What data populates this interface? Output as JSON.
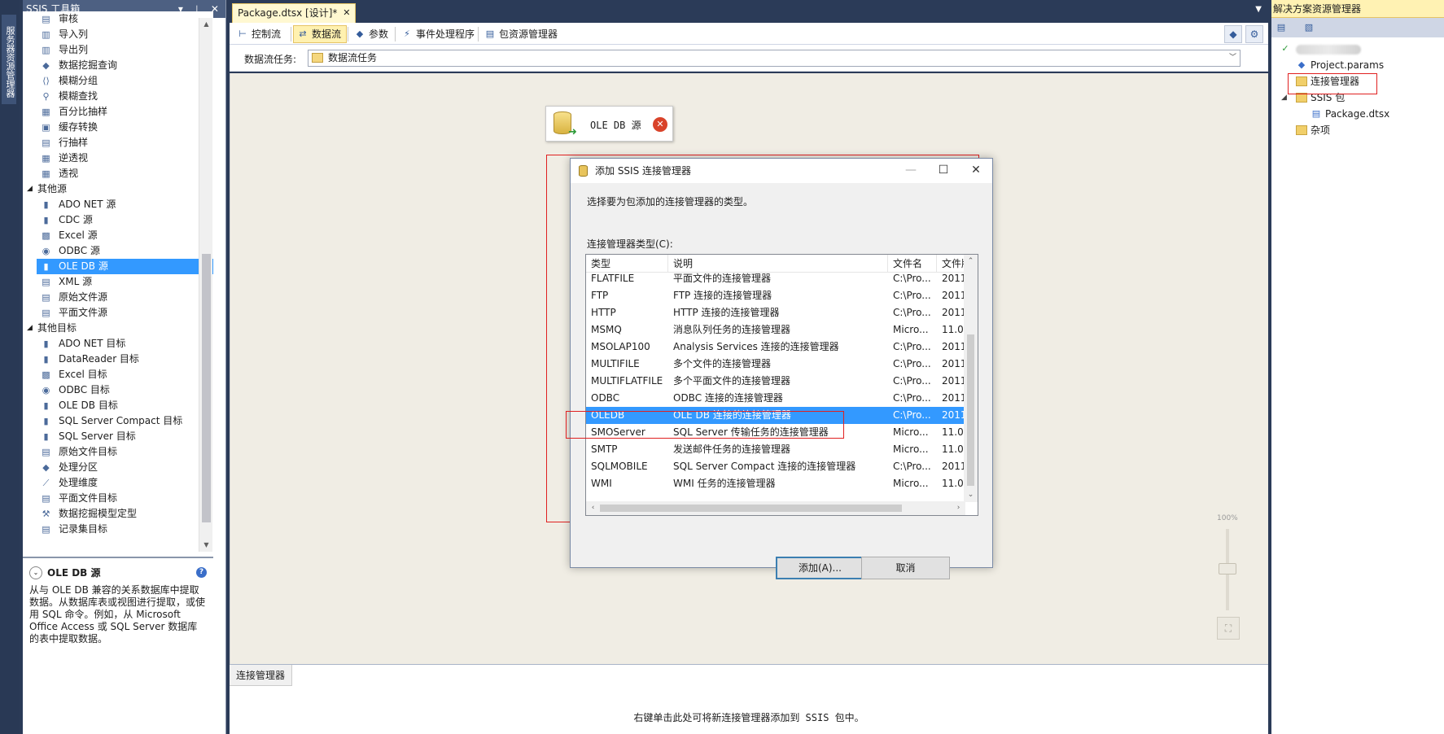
{
  "left_strip": {
    "tab": "服务器资源管理器"
  },
  "toolbox": {
    "title": "SSIS 工具箱",
    "title_buttons": "▾ ⊥ ✕",
    "items_top": [
      {
        "label": "审核",
        "icon": "audit-icon",
        "glyph": "▤"
      },
      {
        "label": "导入列",
        "icon": "import-column-icon",
        "glyph": "▥"
      },
      {
        "label": "导出列",
        "icon": "export-column-icon",
        "glyph": "▥"
      },
      {
        "label": "数据挖掘查询",
        "icon": "data-mining-query-icon",
        "glyph": "◆"
      },
      {
        "label": "模糊分组",
        "icon": "fuzzy-grouping-icon",
        "glyph": "⟨⟩"
      },
      {
        "label": "模糊查找",
        "icon": "fuzzy-lookup-icon",
        "glyph": "⚲"
      },
      {
        "label": "百分比抽样",
        "icon": "percentage-sampling-icon",
        "glyph": "▦"
      },
      {
        "label": "缓存转换",
        "icon": "cache-transform-icon",
        "glyph": "▣"
      },
      {
        "label": "行抽样",
        "icon": "row-sampling-icon",
        "glyph": "▤"
      },
      {
        "label": "逆透视",
        "icon": "unpivot-icon",
        "glyph": "▦"
      },
      {
        "label": "透视",
        "icon": "pivot-icon",
        "glyph": "▦"
      }
    ],
    "group_sources": "其他源",
    "sources": [
      {
        "label": "ADO NET 源",
        "icon": "ado-net-source-icon",
        "glyph": "▮"
      },
      {
        "label": "CDC 源",
        "icon": "cdc-source-icon",
        "glyph": "▮"
      },
      {
        "label": "Excel 源",
        "icon": "excel-source-icon",
        "glyph": "▩"
      },
      {
        "label": "ODBC 源",
        "icon": "odbc-source-icon",
        "glyph": "◉"
      },
      {
        "label": "OLE DB 源",
        "icon": "ole-db-source-icon",
        "glyph": "▮",
        "selected": true
      },
      {
        "label": "XML 源",
        "icon": "xml-source-icon",
        "glyph": "▤"
      },
      {
        "label": "原始文件源",
        "icon": "raw-file-source-icon",
        "glyph": "▤"
      },
      {
        "label": "平面文件源",
        "icon": "flat-file-source-icon",
        "glyph": "▤"
      }
    ],
    "group_destinations": "其他目标",
    "destinations": [
      {
        "label": "ADO NET 目标",
        "icon": "ado-net-destination-icon",
        "glyph": "▮"
      },
      {
        "label": "DataReader 目标",
        "icon": "datareader-destination-icon",
        "glyph": "▮"
      },
      {
        "label": "Excel 目标",
        "icon": "excel-destination-icon",
        "glyph": "▩"
      },
      {
        "label": "ODBC 目标",
        "icon": "odbc-destination-icon",
        "glyph": "◉"
      },
      {
        "label": "OLE DB 目标",
        "icon": "ole-db-destination-icon",
        "glyph": "▮"
      },
      {
        "label": "SQL Server Compact 目标",
        "icon": "sql-compact-destination-icon",
        "glyph": "▮"
      },
      {
        "label": "SQL Server 目标",
        "icon": "sql-server-destination-icon",
        "glyph": "▮"
      },
      {
        "label": "原始文件目标",
        "icon": "raw-file-destination-icon",
        "glyph": "▤"
      },
      {
        "label": "处理分区",
        "icon": "partition-processing-icon",
        "glyph": "◆"
      },
      {
        "label": "处理维度",
        "icon": "dimension-processing-icon",
        "glyph": "⟋"
      },
      {
        "label": "平面文件目标",
        "icon": "flat-file-destination-icon",
        "glyph": "▤"
      },
      {
        "label": "数据挖掘模型定型",
        "icon": "data-mining-training-icon",
        "glyph": "⚒"
      },
      {
        "label": "记录集目标",
        "icon": "recordset-destination-icon",
        "glyph": "▤"
      }
    ],
    "description": {
      "title": "OLE DB 源",
      "text": "从与 OLE DB 兼容的关系数据库中提取数据。从数据库表或视图进行提取，或使用 SQL 命令。例如，从 Microsoft Office Access 或 SQL Server 数据库的表中提取数据。"
    }
  },
  "document": {
    "tab_label": "Package.dtsx [设计]*",
    "designer_tabs": [
      {
        "label": "控制流",
        "icon": "control-flow-icon",
        "glyph": "⊢",
        "active": false
      },
      {
        "label": "数据流",
        "icon": "data-flow-icon",
        "glyph": "⇄",
        "active": true
      },
      {
        "label": "参数",
        "icon": "parameters-icon",
        "glyph": "◆",
        "active": false
      },
      {
        "label": "事件处理程序",
        "icon": "event-handlers-icon",
        "glyph": "⚡",
        "active": false
      },
      {
        "label": "包资源管理器",
        "icon": "package-explorer-icon",
        "glyph": "▤",
        "active": false
      }
    ],
    "task_label": "数据流任务:",
    "task_value": "数据流任务",
    "component": {
      "name": "OLE DB 源"
    },
    "zoom_label": "100%",
    "cm_tab": "连接管理器",
    "cm_hint": "右键单击此处可将新连接管理器添加到 SSIS 包中。"
  },
  "dialog": {
    "title": "添加 SSIS 连接管理器",
    "prompt": "选择要为包添加的连接管理器的类型。",
    "list_label": "连接管理器类型(C):",
    "columns": [
      "类型",
      "说明",
      "文件名",
      "文件版本"
    ],
    "rows": [
      [
        "FLATFILE",
        "平面文件的连接管理器",
        "C:\\Pro...",
        "2011"
      ],
      [
        "FTP",
        "FTP 连接的连接管理器",
        "C:\\Pro...",
        "2011"
      ],
      [
        "HTTP",
        "HTTP 连接的连接管理器",
        "C:\\Pro...",
        "2011"
      ],
      [
        "MSMQ",
        "消息队列任务的连接管理器",
        "Micro...",
        "11.0."
      ],
      [
        "MSOLAP100",
        "Analysis Services 连接的连接管理器",
        "C:\\Pro...",
        "2011"
      ],
      [
        "MULTIFILE",
        "多个文件的连接管理器",
        "C:\\Pro...",
        "2011"
      ],
      [
        "MULTIFLATFILE",
        "多个平面文件的连接管理器",
        "C:\\Pro...",
        "2011"
      ],
      [
        "ODBC",
        "ODBC 连接的连接管理器",
        "C:\\Pro...",
        "2011"
      ],
      [
        "OLEDB",
        "OLE DB 连接的连接管理器",
        "C:\\Pro...",
        "2011"
      ],
      [
        "SMOServer",
        "SQL Server 传输任务的连接管理器",
        "Micro...",
        "11.0."
      ],
      [
        "SMTP",
        "发送邮件任务的连接管理器",
        "Micro...",
        "11.0."
      ],
      [
        "SQLMOBILE",
        "SQL Server Compact 连接的连接管理器",
        "C:\\Pro...",
        "2011"
      ],
      [
        "WMI",
        "WMI 任务的连接管理器",
        "Micro...",
        "11.0."
      ]
    ],
    "selected_row": 8,
    "add_button": "添加(A)...",
    "cancel_button": "取消"
  },
  "solution": {
    "title": "解决方案资源管理器",
    "tree": [
      {
        "label": "Project.params",
        "icon": "params-icon",
        "glyph": "◆"
      },
      {
        "label": "连接管理器",
        "icon": "folder-icon",
        "glyph": ""
      },
      {
        "label": "SSIS 包",
        "icon": "folder-icon",
        "glyph": ""
      },
      {
        "label": "Package.dtsx",
        "icon": "package-icon",
        "glyph": "▤"
      },
      {
        "label": "杂项",
        "icon": "folder-icon",
        "glyph": ""
      }
    ]
  },
  "colors": {
    "selection": "#3399ff",
    "highlight_frame": "#e02020",
    "panel_title": "#4d6082",
    "tab_active": "#fff1b0"
  }
}
